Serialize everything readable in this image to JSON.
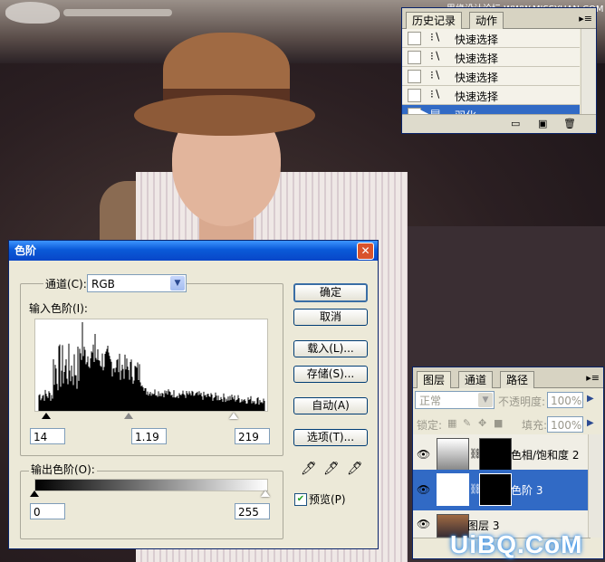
{
  "watermark": {
    "top": "思缘设计论坛  WWW.MISSYUAN.COM",
    "bottom": "UiBQ.CoM"
  },
  "history_panel": {
    "tabs": [
      "历史记录",
      "动作"
    ],
    "menu_icon": "panel-menu-icon",
    "items": [
      {
        "label": "快速选择",
        "icon": "quick-select-icon"
      },
      {
        "label": "快速选择",
        "icon": "quick-select-icon"
      },
      {
        "label": "快速选择",
        "icon": "quick-select-icon"
      },
      {
        "label": "快速选择",
        "icon": "quick-select-icon"
      },
      {
        "label": "羽化",
        "icon": "feather-icon",
        "selected": true
      }
    ]
  },
  "levels_dialog": {
    "title": "色阶",
    "channel_label": "通道(C):",
    "channel_value": "RGB",
    "input_label": "输入色阶(I):",
    "input_values": [
      "14",
      "1.19",
      "219"
    ],
    "output_label": "输出色阶(O):",
    "output_values": [
      "0",
      "255"
    ],
    "buttons": {
      "ok": "确定",
      "cancel": "取消",
      "load": "载入(L)...",
      "save": "存储(S)...",
      "auto": "自动(A)",
      "options": "选项(T)..."
    },
    "preview_label": "预览(P)",
    "preview_checked": true
  },
  "layers_panel": {
    "tabs": [
      "图层",
      "通道",
      "路径"
    ],
    "blend_mode": "正常",
    "opacity_label": "不透明度:",
    "opacity_value": "100%",
    "lock_label": "锁定:",
    "fill_label": "填充:",
    "fill_value": "100%",
    "layers": [
      {
        "name": "色相/饱和度 2",
        "selected": false
      },
      {
        "name": "色阶 3",
        "selected": true
      },
      {
        "name": "图层 3",
        "selected": false
      }
    ]
  }
}
